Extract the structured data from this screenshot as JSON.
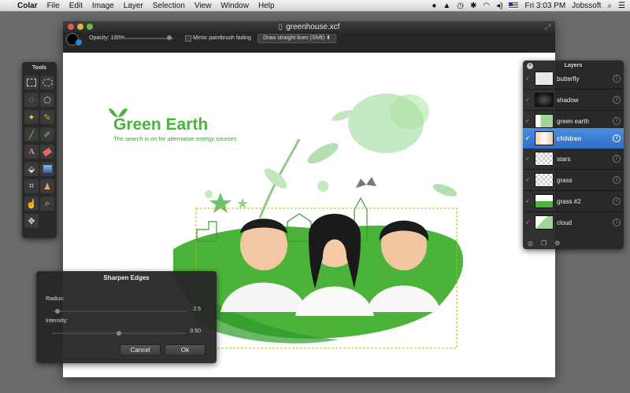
{
  "menubar": {
    "app_name": "Colar",
    "items": [
      "File",
      "Edit",
      "Image",
      "Layer",
      "Selection",
      "View",
      "Window",
      "Help"
    ],
    "clock": "Fri 3:03 PM",
    "user": "Jobssoft"
  },
  "window": {
    "title": "greenhouse.xcf"
  },
  "options": {
    "opacity_label": "Opacity: 100%",
    "opacity_value": 100,
    "mimic_label": "Mimic paintbrush fading",
    "draw_mode": "Draw straight lines (Shift)"
  },
  "artwork": {
    "title": "Green Earth",
    "tagline": "The search is on for alternative energy sources"
  },
  "tools": {
    "title": "Tools",
    "items": [
      "rect-select",
      "ellipse-select",
      "lasso",
      "polygon-lasso",
      "magic-wand",
      "pencil",
      "line",
      "brush",
      "text",
      "eraser",
      "paint-bucket",
      "gradient",
      "crop",
      "clone-stamp",
      "smudge",
      "zoom",
      "move"
    ]
  },
  "layers": {
    "title": "Layers",
    "items": [
      {
        "name": "butterfly",
        "selected": false
      },
      {
        "name": "shadow",
        "selected": false
      },
      {
        "name": "green earth",
        "selected": false
      },
      {
        "name": "children",
        "selected": true
      },
      {
        "name": "stars",
        "selected": false
      },
      {
        "name": "grass",
        "selected": false
      },
      {
        "name": "grass #2",
        "selected": false
      },
      {
        "name": "cloud",
        "selected": false
      }
    ]
  },
  "sharpen_dialog": {
    "title": "Sharpen Edges",
    "radius_label": "Radius:",
    "radius_value": "2.5",
    "intensity_label": "Intensity:",
    "intensity_value": "0.50",
    "cancel_label": "Cancel",
    "ok_label": "Ok"
  },
  "colors": {
    "accent": "#2f6ec5",
    "brand_green": "#4bb33a",
    "selection_marquee": "#c8b400"
  }
}
